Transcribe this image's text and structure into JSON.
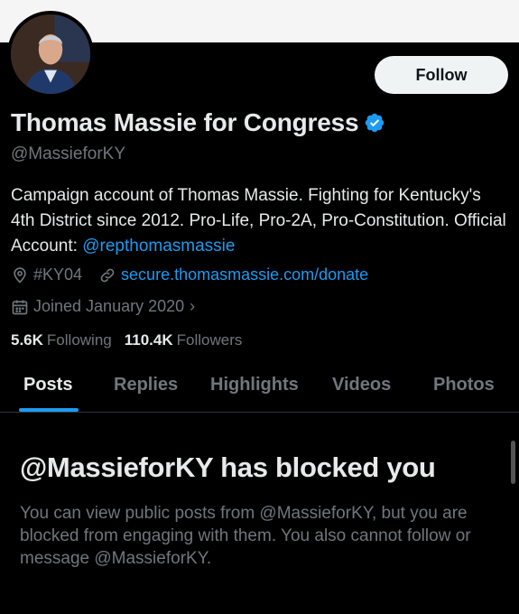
{
  "profile": {
    "name": "Thomas Massie for Congress",
    "handle": "@MassieforKY",
    "follow_label": "Follow",
    "bio_text": "Campaign account of Thomas Massie. Fighting for Kentucky's 4th District since 2012. Pro-Life, Pro-2A, Pro-Constitution. Official Account: ",
    "bio_mention": "@repthomasmassie",
    "location": "#KY04",
    "website": "secure.thomasmassie.com/donate",
    "joined": "Joined January 2020",
    "following_count": "5.6K",
    "following_label": "Following",
    "followers_count": "110.4K",
    "followers_label": "Followers"
  },
  "tabs": [
    {
      "label": "Posts",
      "active": true
    },
    {
      "label": "Replies",
      "active": false
    },
    {
      "label": "Highlights",
      "active": false
    },
    {
      "label": "Videos",
      "active": false
    },
    {
      "label": "Photos",
      "active": false
    }
  ],
  "blocked": {
    "title": "@MassieforKY has blocked you",
    "message": "You can view public posts from @MassieforKY, but you are blocked from engaging with them. You also cannot follow or message @MassieforKY."
  },
  "colors": {
    "accent": "#1d9bf0",
    "background": "#000000",
    "secondary_text": "#71767b",
    "primary_text": "#e7e9ea"
  },
  "icons": {
    "verified": "verified-badge-icon",
    "location": "location-pin-icon",
    "link": "link-icon",
    "calendar": "calendar-icon"
  }
}
